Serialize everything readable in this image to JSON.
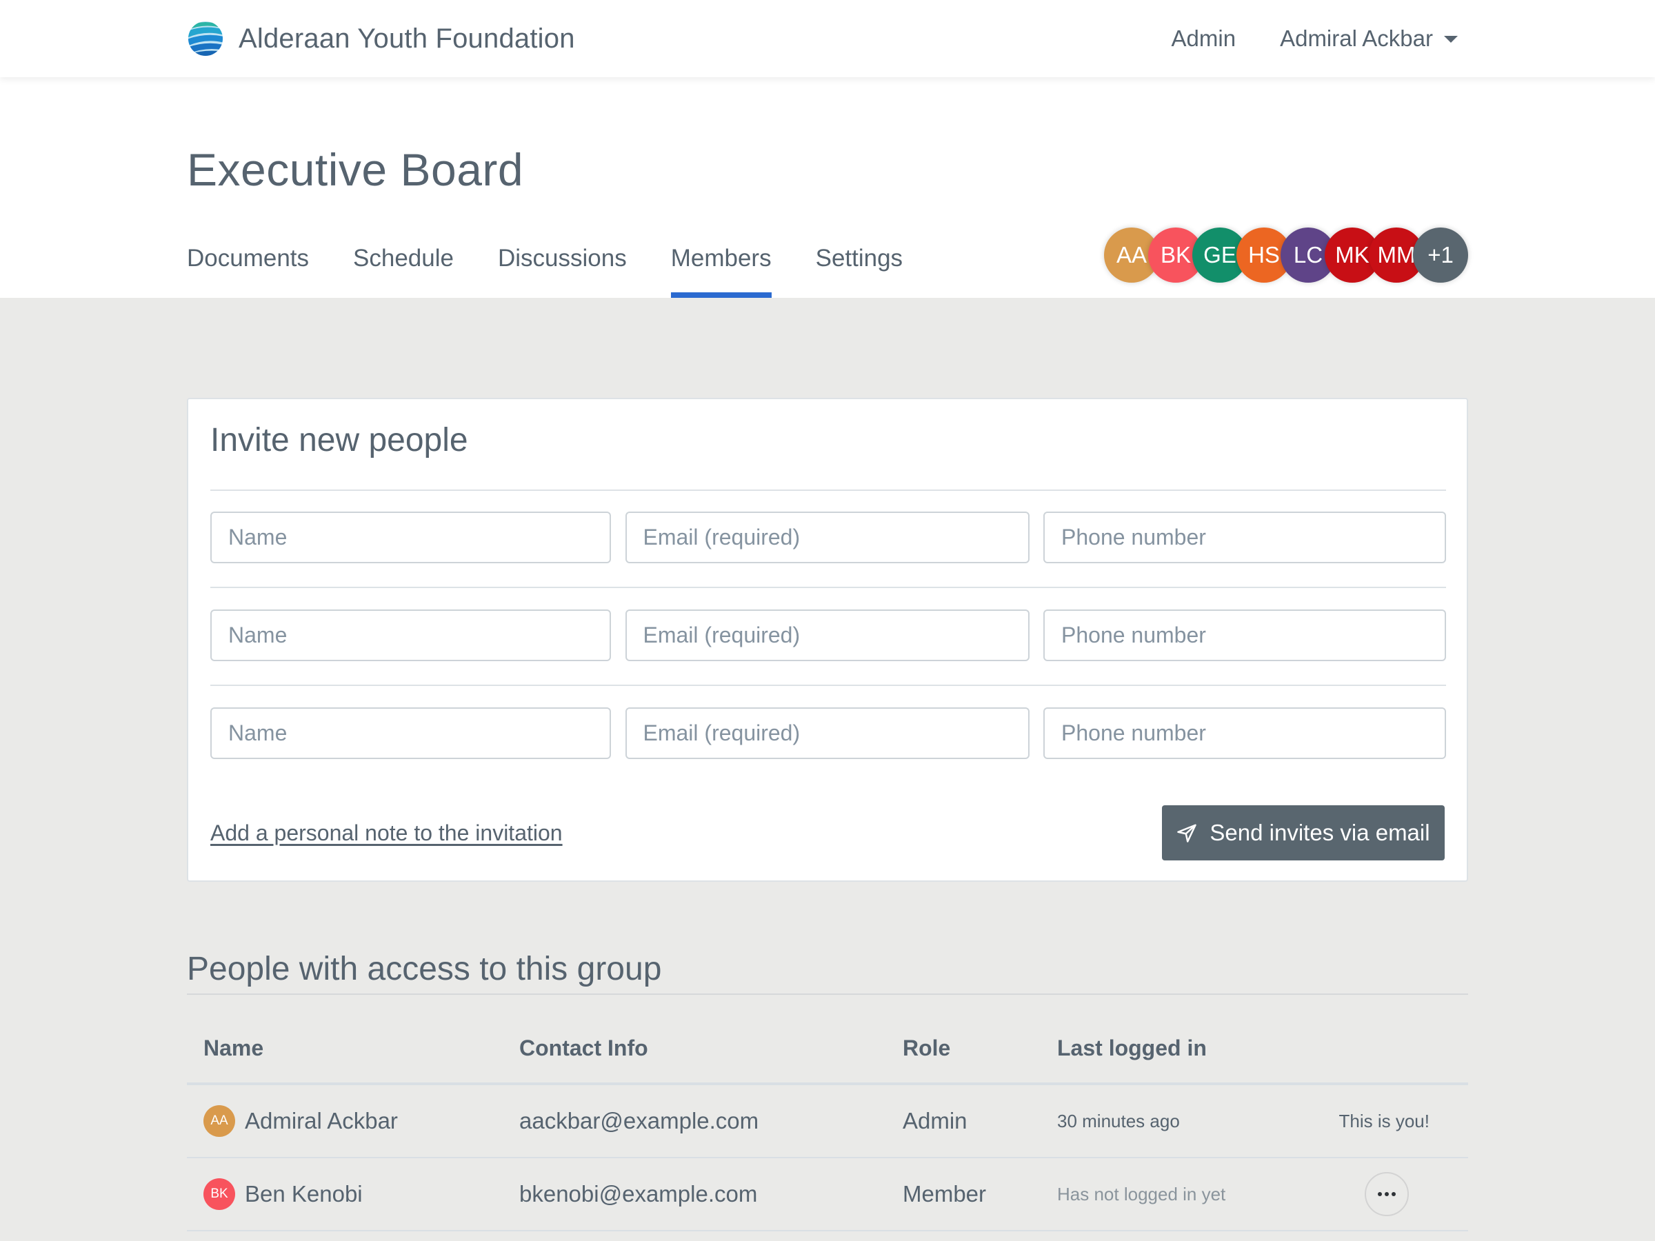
{
  "header": {
    "brand_name": "Alderaan Youth Foundation",
    "logo_icon": "globe-icon",
    "nav": {
      "admin_label": "Admin",
      "user_label": "Admiral Ackbar"
    }
  },
  "page": {
    "title": "Executive Board",
    "tabs": [
      {
        "label": "Documents",
        "active": false
      },
      {
        "label": "Schedule",
        "active": false
      },
      {
        "label": "Discussions",
        "active": false
      },
      {
        "label": "Members",
        "active": true
      },
      {
        "label": "Settings",
        "active": false
      }
    ],
    "member_avatars": [
      {
        "initials": "AA",
        "color": "#d99a4c"
      },
      {
        "initials": "BK",
        "color": "#f8535d"
      },
      {
        "initials": "GE",
        "color": "#128f6a"
      },
      {
        "initials": "HS",
        "color": "#ec6622"
      },
      {
        "initials": "LC",
        "color": "#5f4488"
      },
      {
        "initials": "MK",
        "color": "#c80f15"
      },
      {
        "initials": "MM",
        "color": "#c80f15"
      },
      {
        "initials": "+1",
        "color": "#59666f"
      }
    ]
  },
  "invite": {
    "title": "Invite new people",
    "rows": [
      {
        "name_placeholder": "Name",
        "email_placeholder": "Email (required)",
        "phone_placeholder": "Phone number",
        "name_value": "",
        "email_value": "",
        "phone_value": ""
      },
      {
        "name_placeholder": "Name",
        "email_placeholder": "Email (required)",
        "phone_placeholder": "Phone number",
        "name_value": "",
        "email_value": "",
        "phone_value": ""
      },
      {
        "name_placeholder": "Name",
        "email_placeholder": "Email (required)",
        "phone_placeholder": "Phone number",
        "name_value": "",
        "email_value": "",
        "phone_value": ""
      }
    ],
    "note_link": "Add a personal note to the invitation",
    "send_button": "Send invites via email",
    "send_icon": "paper-plane-icon"
  },
  "people": {
    "title": "People with access to this group",
    "columns": [
      "Name",
      "Contact Info",
      "Role",
      "Last logged in"
    ],
    "rows": [
      {
        "initials": "AA",
        "avatar_color": "#d99a4c",
        "name": "Admiral Ackbar",
        "contact": "aackbar@example.com",
        "role": "Admin",
        "last_logged_in": "30 minutes ago",
        "action": "This is you!"
      },
      {
        "initials": "BK",
        "avatar_color": "#f8535d",
        "name": "Ben Kenobi",
        "contact": "bkenobi@example.com",
        "role": "Member",
        "last_logged_in": "Has not logged in yet",
        "action": "more-options"
      }
    ]
  },
  "colors": {
    "accent": "#2b6ad0",
    "text": "#56636f",
    "button": "#59666f",
    "background": "#eaeae8"
  }
}
